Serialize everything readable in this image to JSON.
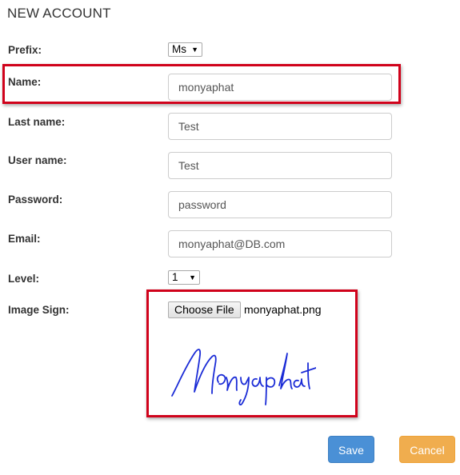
{
  "page": {
    "title": "NEW ACCOUNT"
  },
  "form": {
    "prefix": {
      "label": "Prefix:",
      "value": "Ms"
    },
    "name": {
      "label": "Name:",
      "value": "monyaphat"
    },
    "last_name": {
      "label": "Last name:",
      "value": "Test"
    },
    "user_name": {
      "label": "User name:",
      "value": "Test"
    },
    "password": {
      "label": "Password:",
      "value": "password"
    },
    "email": {
      "label": "Email:",
      "value": "monyaphat@DB.com"
    },
    "level": {
      "label": "Level:",
      "value": "1"
    },
    "image_sign": {
      "label": "Image Sign:",
      "button_label": "Choose File",
      "file_name": "monyaphat.png",
      "signature_text": "Monyaphat"
    }
  },
  "actions": {
    "save_label": "Save",
    "cancel_label": "Cancel"
  },
  "colors": {
    "highlight": "#d0021b",
    "save": "#4a90d6",
    "cancel": "#f0ad4e",
    "signature_ink": "#1a2bd6"
  },
  "icons": {
    "select_arrow": "caret-down-icon"
  }
}
